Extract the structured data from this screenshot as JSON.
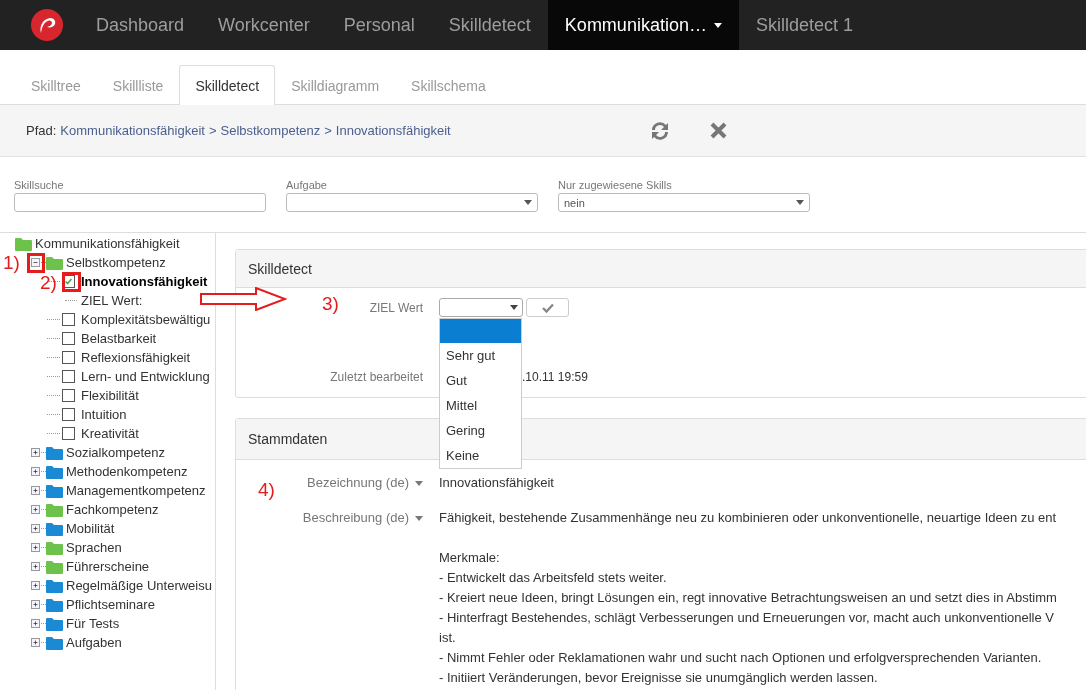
{
  "navbar": {
    "items": [
      {
        "label": "Dashboard",
        "selected": false,
        "dropdown": false
      },
      {
        "label": "Workcenter",
        "selected": false,
        "dropdown": false
      },
      {
        "label": "Personal",
        "selected": false,
        "dropdown": false
      },
      {
        "label": "Skilldetect",
        "selected": false,
        "dropdown": false
      },
      {
        "label": "Kommunikation…",
        "selected": true,
        "dropdown": true
      },
      {
        "label": "Skilldetect 1",
        "selected": false,
        "dropdown": false
      }
    ]
  },
  "tabs": [
    {
      "label": "Skilltree",
      "selected": false
    },
    {
      "label": "Skillliste",
      "selected": false
    },
    {
      "label": "Skilldetect",
      "selected": true
    },
    {
      "label": "Skilldiagramm",
      "selected": false
    },
    {
      "label": "Skillschema",
      "selected": false
    }
  ],
  "path": {
    "label": "Pfad:",
    "crumbs": [
      "Kommunikationsfähigkeit",
      "Selbstkompetenz",
      "Innovationsfähigkeit"
    ],
    "separators": [
      ">",
      ">"
    ]
  },
  "filters": [
    {
      "label": "Skillsuche",
      "kind": "text"
    },
    {
      "label": "Aufgabe",
      "kind": "select"
    },
    {
      "label": "Nur zugewiesene Skills",
      "kind": "select",
      "value": "nein"
    }
  ],
  "tree": [
    {
      "label": "Kommunikationsfähigkeit",
      "kind": "folder",
      "color": "#6cc24a",
      "selected": false,
      "children": [
        {
          "label": "Selbstkompetenz",
          "kind": "folder",
          "color": "#6cc24a",
          "selected": false,
          "expanded": true,
          "children": [
            {
              "label": "Innovationsfähigkeit",
              "kind": "check",
              "checked": true,
              "selected": true,
              "children": [
                {
                  "label": "ZIEL Wert:",
                  "kind": "value"
                }
              ]
            },
            {
              "label": "Komplexitätsbewältigu",
              "kind": "check",
              "checked": false,
              "selected": false
            },
            {
              "label": "Belastbarkeit",
              "kind": "check",
              "checked": false,
              "selected": false
            },
            {
              "label": "Reflexionsfähigkeit",
              "kind": "check",
              "checked": false,
              "selected": false
            },
            {
              "label": "Lern- und Entwicklung",
              "kind": "check",
              "checked": false,
              "selected": false
            },
            {
              "label": "Flexibilität",
              "kind": "check",
              "checked": false,
              "selected": false
            },
            {
              "label": "Intuition",
              "kind": "check",
              "checked": false,
              "selected": false
            },
            {
              "label": "Kreativität",
              "kind": "check",
              "checked": false,
              "selected": false
            }
          ]
        },
        {
          "label": "Sozialkompetenz",
          "kind": "folder",
          "color": "#1a8ad4",
          "selected": false,
          "expanded": false
        },
        {
          "label": "Methodenkompetenz",
          "kind": "folder",
          "color": "#1a8ad4",
          "selected": false,
          "expanded": false
        },
        {
          "label": "Managementkompetenz",
          "kind": "folder",
          "color": "#1a8ad4",
          "selected": false,
          "expanded": false
        },
        {
          "label": "Fachkompetenz",
          "kind": "folder",
          "color": "#6cc24a",
          "selected": false,
          "expanded": false
        },
        {
          "label": "Mobilität",
          "kind": "folder",
          "color": "#1a8ad4",
          "selected": false,
          "expanded": false
        },
        {
          "label": "Sprachen",
          "kind": "folder",
          "color": "#6cc24a",
          "selected": false,
          "expanded": false
        },
        {
          "label": "Führerscheine",
          "kind": "folder",
          "color": "#6cc24a",
          "selected": false,
          "expanded": false
        },
        {
          "label": "Regelmäßige Unterweisu",
          "kind": "folder",
          "color": "#1a8ad4",
          "selected": false,
          "expanded": false
        },
        {
          "label": "Pflichtseminare",
          "kind": "folder",
          "color": "#1a8ad4",
          "selected": false,
          "expanded": false
        },
        {
          "label": "Für Tests",
          "kind": "folder",
          "color": "#1a8ad4",
          "selected": false,
          "expanded": false
        },
        {
          "label": "Aufgaben",
          "kind": "folder",
          "color": "#1a8ad4",
          "selected": false,
          "expanded": false
        }
      ]
    }
  ],
  "skilldetect": {
    "title": "Skilldetect",
    "field_label": "ZIEL Wert",
    "dropdown": {
      "blank_highlighted": true,
      "options": [
        "Sehr gut",
        "Gut",
        "Mittel",
        "Gering",
        "Keine"
      ]
    },
    "last_edited": {
      "label": "Zuletzt bearbeitet",
      "value": ".10.11 19:59"
    }
  },
  "stammdaten": {
    "title": "Stammdaten",
    "rows": [
      {
        "label": "Bezeichnung (de)",
        "paragraphs": [
          [
            "Innovationsfähigkeit"
          ]
        ]
      },
      {
        "label": "Beschreibung (de)",
        "paragraphs": [
          [
            "Fähigkeit, bestehende Zusammenhänge neu zu kombinieren oder unkonventionelle, neuartige Ideen zu ent"
          ],
          [
            "Merkmale:",
            "- Entwickelt das Arbeitsfeld stets weiter.",
            "- Kreiert neue Ideen, bringt Lösungen ein, regt innovative Betrachtungsweisen an und setzt dies in Abstimm",
            "- Hinterfragt Bestehendes, schlägt Verbesserungen und Erneuerungen vor, macht auch unkonventionelle V",
            "ist.",
            "- Nimmt Fehler oder Reklamationen wahr und sucht nach Optionen und erfolgversprechenden Varianten.",
            "- Initiiert Veränderungen, bevor Ereignisse sie unumgänglich werden lassen."
          ]
        ]
      }
    ]
  },
  "annotations": {
    "markers": [
      "1)",
      "2)",
      "3)",
      "4)"
    ],
    "highlight_boxes": true,
    "arrow": true
  }
}
